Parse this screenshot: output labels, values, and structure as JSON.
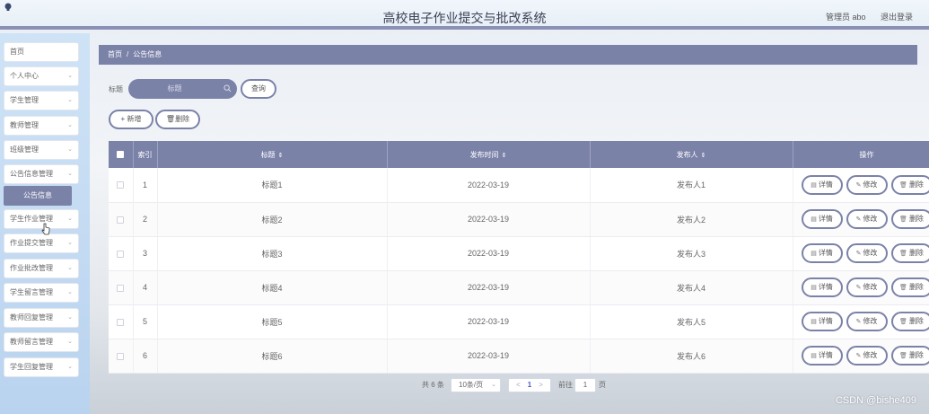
{
  "header": {
    "title": "高校电子作业提交与批改系统",
    "user": "管理员 abo",
    "logout": "退出登录"
  },
  "sidebar": {
    "items": [
      {
        "label": "首页",
        "chevron": false
      },
      {
        "label": "个人中心",
        "chevron": true
      },
      {
        "label": "学生管理",
        "chevron": true
      },
      {
        "label": "教师管理",
        "chevron": true
      },
      {
        "label": "班级管理",
        "chevron": true
      },
      {
        "label": "公告信息管理",
        "chevron": true
      },
      {
        "label": "学生作业管理",
        "chevron": true
      },
      {
        "label": "作业提交管理",
        "chevron": true
      },
      {
        "label": "作业批改管理",
        "chevron": true
      },
      {
        "label": "学生留言管理",
        "chevron": true
      },
      {
        "label": "教师回复管理",
        "chevron": true
      },
      {
        "label": "教师留言管理",
        "chevron": true
      },
      {
        "label": "学生回复管理",
        "chevron": true
      }
    ],
    "sub_item": "公告信息"
  },
  "breadcrumb": {
    "home": "首页",
    "separator": "/",
    "current": "公告信息"
  },
  "search": {
    "label": "标题",
    "placeholder": "标题",
    "button": "查询"
  },
  "toolbar": {
    "add": "+ 新增",
    "delete": "删除"
  },
  "table": {
    "headers": [
      "索引",
      "标题",
      "发布时间",
      "发布人",
      "操作"
    ],
    "rows": [
      {
        "index": "1",
        "title": "标题1",
        "date": "2022-03-19",
        "publisher": "发布人1"
      },
      {
        "index": "2",
        "title": "标题2",
        "date": "2022-03-19",
        "publisher": "发布人2"
      },
      {
        "index": "3",
        "title": "标题3",
        "date": "2022-03-19",
        "publisher": "发布人3"
      },
      {
        "index": "4",
        "title": "标题4",
        "date": "2022-03-19",
        "publisher": "发布人4"
      },
      {
        "index": "5",
        "title": "标题5",
        "date": "2022-03-19",
        "publisher": "发布人5"
      },
      {
        "index": "6",
        "title": "标题6",
        "date": "2022-03-19",
        "publisher": "发布人6"
      }
    ],
    "actions": {
      "detail": "详情",
      "edit": "修改",
      "delete": "删除"
    }
  },
  "pagination": {
    "total": "共 6 条",
    "page_size": "10条/页",
    "prev": "<",
    "current_page": "1",
    "next": ">",
    "goto_label": "前往",
    "goto_value": "1",
    "page_suffix": "页"
  },
  "watermark": "CSDN @bishe409",
  "colors": {
    "accent": "#7b82a8",
    "sidebar": "#c4dbf3",
    "header_border": "#8a91b4"
  },
  "icons": [
    "logo-icon",
    "chevron-down-icon",
    "search-icon",
    "trash-icon",
    "detail-icon",
    "edit-icon",
    "sort-icon",
    "cursor-icon"
  ]
}
